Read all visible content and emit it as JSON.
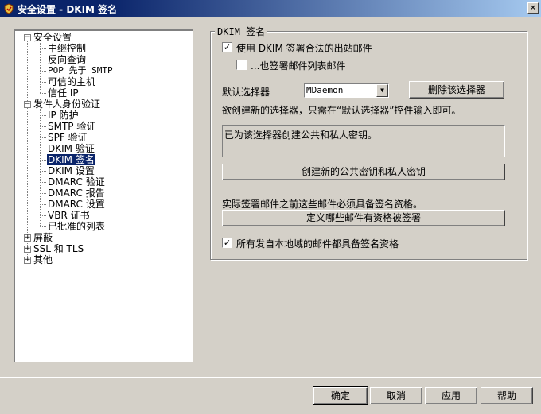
{
  "window": {
    "title": "安全设置 - DKIM 签名",
    "close_glyph": "✕"
  },
  "tree": {
    "items": [
      {
        "label": "安全设置",
        "expander": "−"
      },
      {
        "label": "中继控制"
      },
      {
        "label": "反向查询"
      },
      {
        "label": "POP 先于 SMTP"
      },
      {
        "label": "可信的主机"
      },
      {
        "label": "信任 IP"
      },
      {
        "label": "发件人身份验证",
        "expander": "−"
      },
      {
        "label": "IP 防护"
      },
      {
        "label": "SMTP 验证"
      },
      {
        "label": "SPF 验证"
      },
      {
        "label": "DKIM 验证"
      },
      {
        "label": "DKIM 签名",
        "selected": true
      },
      {
        "label": "DKIM 设置"
      },
      {
        "label": "DMARC 验证"
      },
      {
        "label": "DMARC 报告"
      },
      {
        "label": "DMARC 设置"
      },
      {
        "label": "VBR 证书"
      },
      {
        "label": "已批准的列表"
      },
      {
        "label": "屏蔽",
        "expander": "+"
      },
      {
        "label": "SSL 和 TLS",
        "expander": "+"
      },
      {
        "label": "其他",
        "expander": "+"
      }
    ]
  },
  "dkim": {
    "group_title": "DKIM 签名",
    "sign_checkbox_label": "使用 DKIM 签署合法的出站邮件",
    "sign_checked": "✓",
    "list_checkbox_label": "...也签署邮件列表邮件",
    "list_checked": "",
    "default_selector_label": "默认选择器",
    "selector_value": "MDaemon",
    "delete_selector_button": "删除该选择器",
    "hint_text": "欲创建新的选择器，只需在“默认选择器”控件输入即可。",
    "status_text": "已为该选择器创建公共和私人密钥。",
    "create_keys_button": "创建新的公共密钥和私人密钥",
    "qualify_text": "实际签署邮件之前这些邮件必须具备签名资格。",
    "define_button": "定义哪些邮件有资格被签署",
    "local_checkbox_label": "所有发自本地域的邮件都具备签名资格",
    "local_checked": "✓"
  },
  "buttons": {
    "ok": "确定",
    "cancel": "取消",
    "apply": "应用",
    "help": "帮助"
  },
  "colors": {
    "selection": "#0a246a",
    "face": "#d4d0c8",
    "title_gradient_end": "#a6caf0"
  }
}
